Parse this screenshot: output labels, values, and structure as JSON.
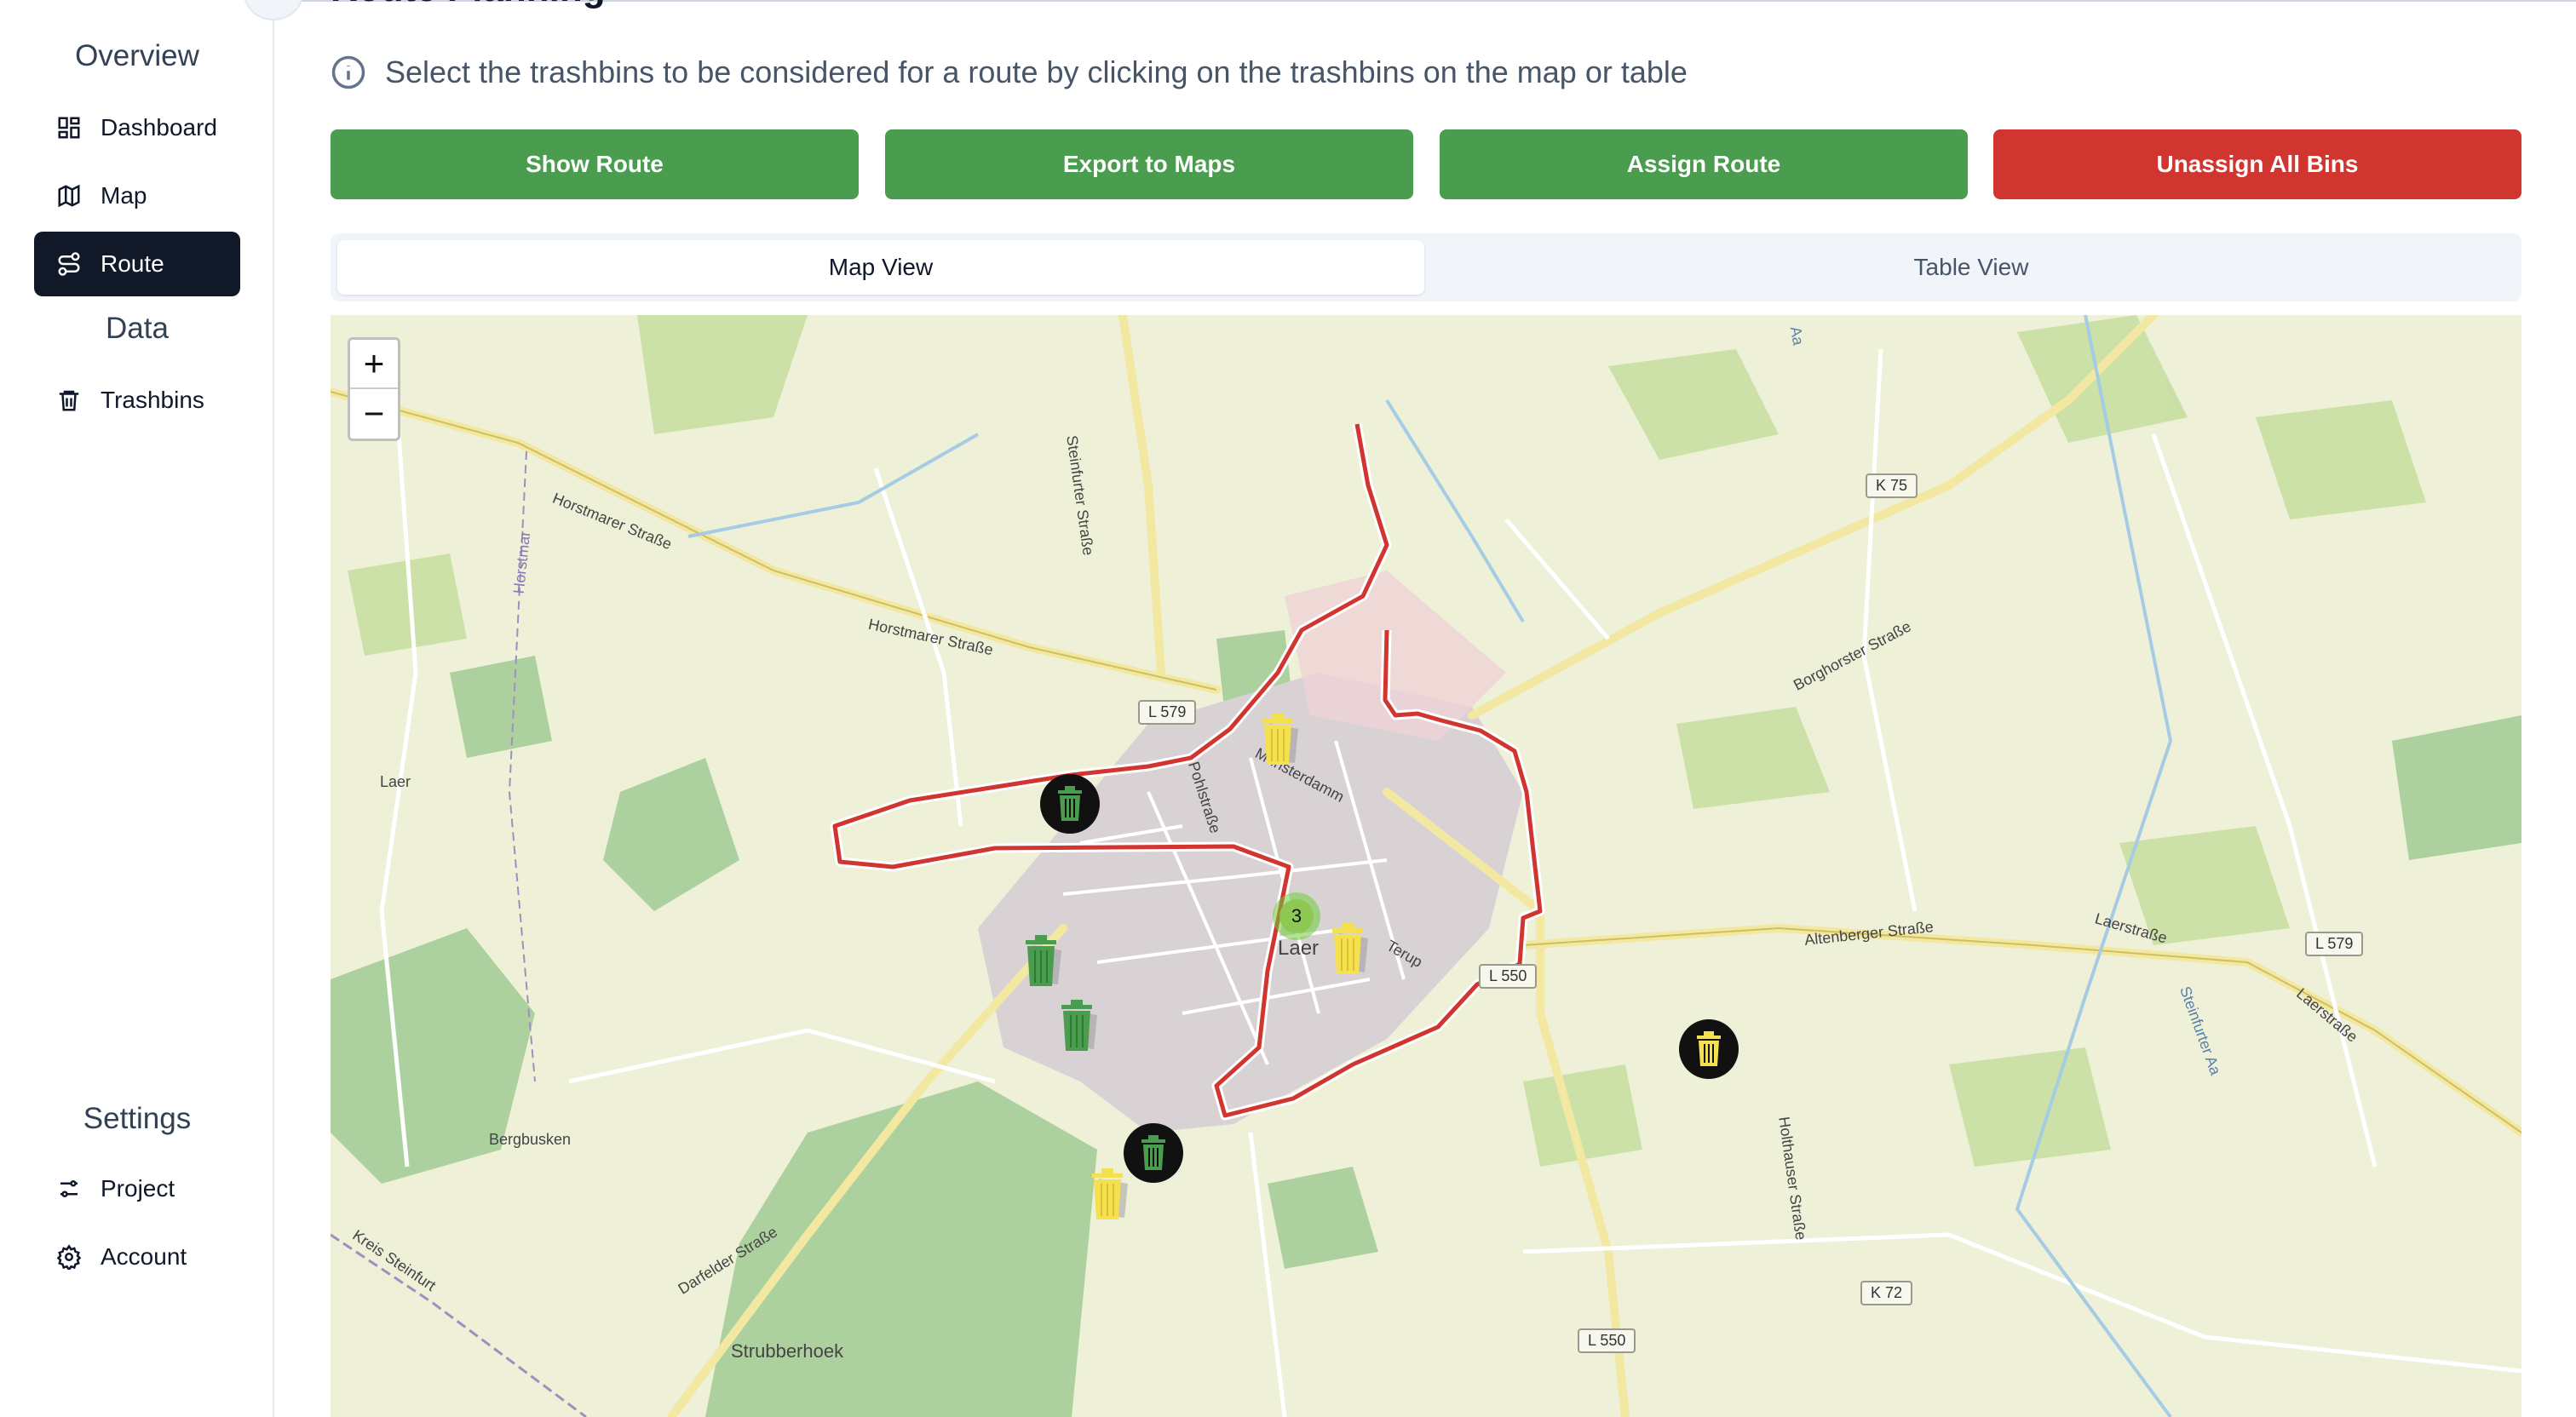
{
  "sidebar": {
    "overview_title": "Overview",
    "data_title": "Data",
    "settings_title": "Settings",
    "items": [
      {
        "label": "Dashboard",
        "icon": "dashboard-icon"
      },
      {
        "label": "Map",
        "icon": "map-icon"
      },
      {
        "label": "Route",
        "icon": "route-icon",
        "active": true
      },
      {
        "label": "Trashbins",
        "icon": "trash-icon"
      },
      {
        "label": "Project",
        "icon": "sliders-icon"
      },
      {
        "label": "Account",
        "icon": "gear-icon"
      }
    ]
  },
  "header": {
    "title": "Route Planning"
  },
  "info_text": "Select the trashbins to be considered for a route by clicking on the trashbins on the map or table",
  "buttons": {
    "show_route": "Show Route",
    "export": "Export to Maps",
    "assign": "Assign Route",
    "unassign": "Unassign All Bins"
  },
  "tabs": {
    "map_view": "Map View",
    "table_view": "Table View"
  },
  "map": {
    "zoom_in": "+",
    "zoom_out": "−",
    "cluster_count": "3",
    "labels": {
      "horstmarer1": "Horstmarer Straße",
      "horstmarer2": "Horstmarer Straße",
      "steinfurter": "Steinfurter Straße",
      "muensterdamm": "Münsterdamm",
      "pohlstrasse": "Pohlstraße",
      "laer_town": "Laer",
      "terup": "Terup",
      "borghorster": "Borghorster Straße",
      "altenberger": "Altenberger Straße",
      "laerstrasse1": "Laerstraße",
      "laerstrasse2": "Laerstraße",
      "steinfurter_aa": "Steinfurter Aa",
      "holthauser": "Holthauser Straße",
      "darfelder": "Darfelder Straße",
      "bergbusken": "Bergbusken",
      "strubberhoek": "Strubberhoek",
      "kreis": "Kreis Steinfurt",
      "laer_west": "Laer",
      "horstmar": "Horstmar",
      "aa": "Aa"
    },
    "badges": {
      "l579a": "L 579",
      "l579b": "L 579",
      "l550a": "L 550",
      "l550b": "L 550",
      "k75": "K 75",
      "k72": "K 72"
    },
    "colors": {
      "route": "#d03530",
      "bin_assigned": "#4a9d4e",
      "bin_unassigned": "#f5e050",
      "bin_selected_bg": "#111111"
    }
  }
}
